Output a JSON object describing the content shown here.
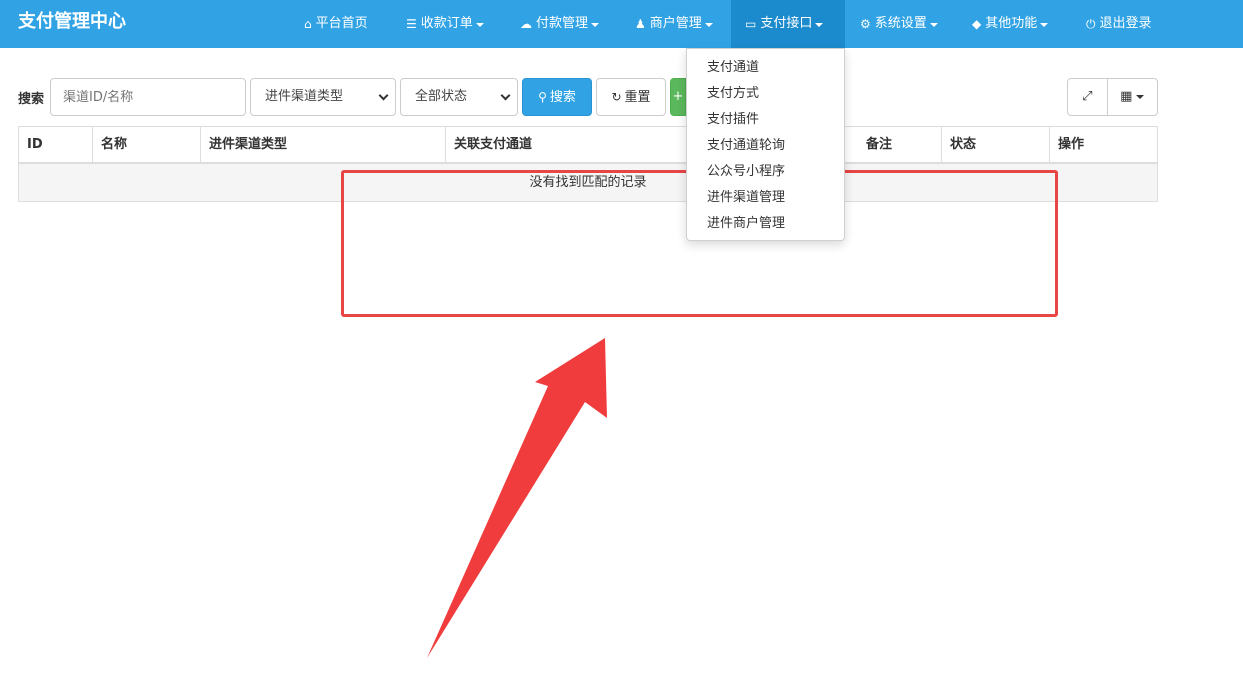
{
  "navbar": {
    "brand": "支付管理中心",
    "items": [
      {
        "label": "平台首页",
        "icon": "home-icon",
        "glyph": "⌂",
        "has_caret": false
      },
      {
        "label": "收款订单",
        "icon": "list-icon",
        "glyph": "☰",
        "has_caret": true
      },
      {
        "label": "付款管理",
        "icon": "cloud-icon",
        "glyph": "☁",
        "has_caret": true
      },
      {
        "label": "商户管理",
        "icon": "user-icon",
        "glyph": "♟",
        "has_caret": true
      },
      {
        "label": "支付接口",
        "icon": "credit-card-icon",
        "glyph": "▭",
        "has_caret": true,
        "active": true
      },
      {
        "label": "系统设置",
        "icon": "gear-icon",
        "glyph": "⚙",
        "has_caret": true
      },
      {
        "label": "其他功能",
        "icon": "cube-icon",
        "glyph": "◆",
        "has_caret": true
      },
      {
        "label": "退出登录",
        "icon": "power-icon",
        "glyph": "⏻",
        "has_caret": false
      }
    ]
  },
  "dropdown": {
    "items": [
      "支付通道",
      "支付方式",
      "支付插件",
      "支付通道轮询",
      "公众号小程序",
      "进件渠道管理",
      "进件商户管理"
    ]
  },
  "toolbar": {
    "search_label": "搜索",
    "search_placeholder": "渠道ID/名称",
    "channel_type_select": "进件渠道类型",
    "status_select": "全部状态",
    "search_button": "搜索",
    "reset_button": "重置",
    "add_button": "+",
    "fullscreen_icon": "fullscreen-icon",
    "columns_icon": "grid-icon"
  },
  "table": {
    "columns": [
      "ID",
      "名称",
      "进件渠道类型",
      "关联支付通道",
      "",
      "备注",
      "状态",
      "操作"
    ],
    "empty_text": "没有找到匹配的记录"
  },
  "colors": {
    "navbar": "#31a3e5",
    "navbar_active": "#1c8bcd",
    "annotation": "#e84545"
  }
}
